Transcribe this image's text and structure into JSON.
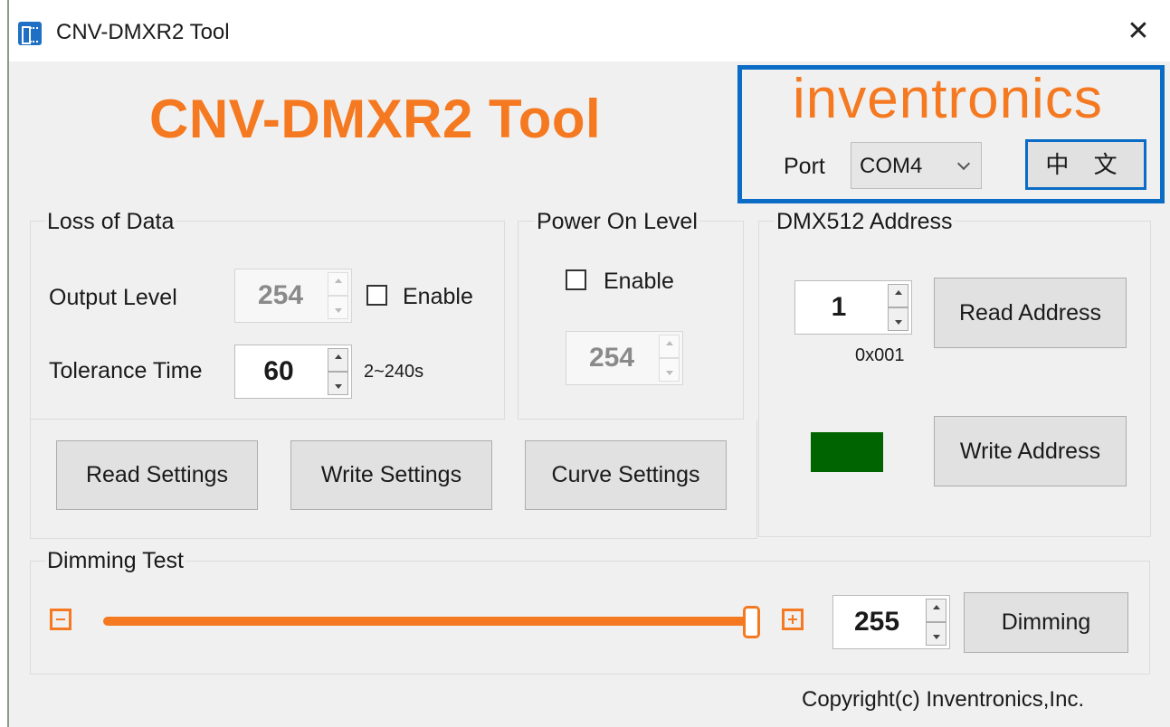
{
  "window": {
    "title": "CNV-DMXR2 Tool",
    "app_icon": "app-icon",
    "close_glyph": "✕"
  },
  "header": {
    "title": "CNV-DMXR2 Tool",
    "brand": "inventronics",
    "port_label": "Port",
    "port_value": "COM4",
    "language_button": "中 文"
  },
  "loss_of_data": {
    "title": "Loss of Data",
    "output_level_label": "Output Level",
    "output_level_value": "254",
    "enable_label": "Enable",
    "enable_checked": false,
    "tolerance_label": "Tolerance Time",
    "tolerance_value": "60",
    "tolerance_range": "2~240s"
  },
  "power_on_level": {
    "title": "Power On Level",
    "enable_label": "Enable",
    "enable_checked": false,
    "value": "254"
  },
  "settings_buttons": {
    "read": "Read Settings",
    "write": "Write Settings",
    "curve": "Curve Settings"
  },
  "dmx_address": {
    "title": "DMX512 Address",
    "value": "1",
    "hex": "0x001",
    "read_button": "Read Address",
    "write_button": "Write Address",
    "status_color": "#006400"
  },
  "dimming_test": {
    "title": "Dimming Test",
    "slider_value": 255,
    "slider_max": 255,
    "value": "255",
    "button": "Dimming"
  },
  "footer": {
    "copyright": "Copyright(c) Inventronics,Inc."
  },
  "colors": {
    "accent": "#f47920",
    "highlight_border": "#0a6cc4"
  }
}
